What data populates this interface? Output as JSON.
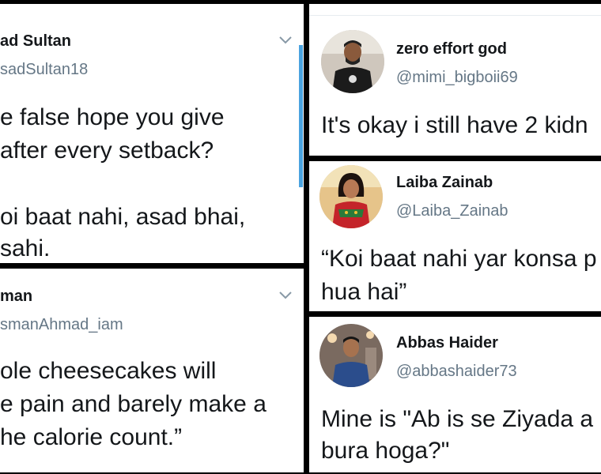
{
  "tweets": [
    {
      "name": "ad Sultan",
      "handle": "sadSultan18",
      "lines": [
        "e false hope you give",
        "after every setback?",
        "",
        "oi baat nahi, asad bhai,",
        "sahi."
      ],
      "icon": "chevron-down-icon"
    },
    {
      "name": "man",
      "handle": "smanAhmad_iam",
      "lines": [
        "ole cheesecakes will",
        "e pain and barely make a",
        "he calorie count.”"
      ],
      "icon": "chevron-down-icon"
    },
    {
      "name": "zero effort god",
      "handle": "@mimi_bigboii69",
      "lines": [
        "It's okay i still have 2 kidn"
      ],
      "avatar": "avatar-man-dark-shirt"
    },
    {
      "name": "Laiba Zainab",
      "handle": "@Laiba_Zainab",
      "lines": [
        "“Koi baat nahi yar konsa p",
        "hua hai”"
      ],
      "avatar": "avatar-woman-red-dress"
    },
    {
      "name": "Abbas Haider",
      "handle": "@abbashaider73",
      "lines": [
        "Mine is \"Ab is se Ziyada a",
        "bura hoga?\""
      ],
      "avatar": "avatar-man-blue-shirt"
    }
  ],
  "colors": {
    "name": "#14171a",
    "handle": "#657786",
    "accent": "#4aa3df",
    "separator": "#000000"
  }
}
